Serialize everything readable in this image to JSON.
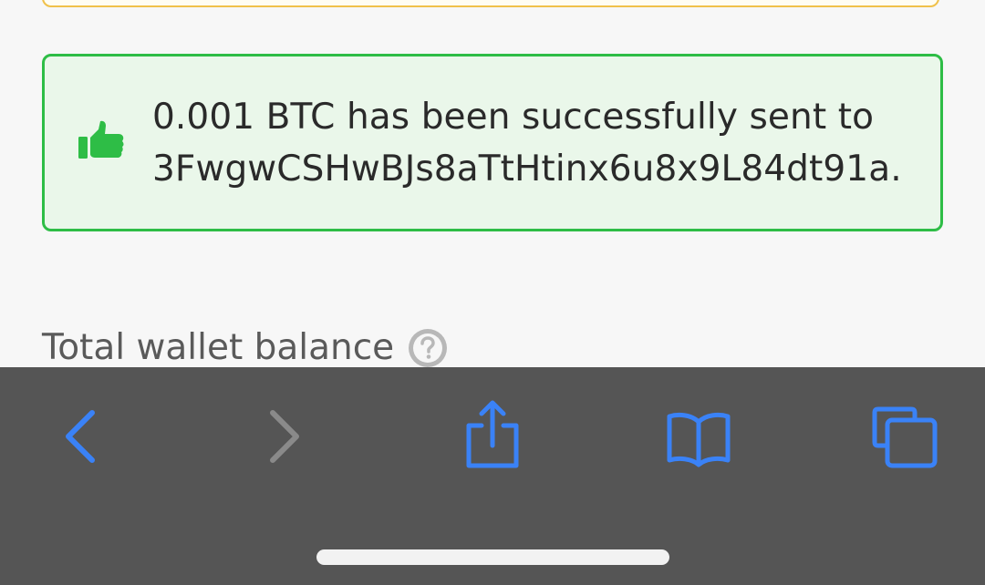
{
  "alert": {
    "message": "0.001 BTC has been successfully sent to 3FwgwCSHwBJs8aTtHtinx6u8x9L84dt91a.",
    "icon": "thumbs-up-icon",
    "accent_color": "#2ebd46"
  },
  "balance": {
    "label": "Total wallet balance",
    "help_icon": "question-circle-icon"
  },
  "toolbar": {
    "background": "#555555",
    "active_color": "#3a82f7",
    "disabled_color": "#8a8a8a",
    "buttons": [
      {
        "name": "back",
        "icon": "chevron-left-icon",
        "enabled": true
      },
      {
        "name": "forward",
        "icon": "chevron-right-icon",
        "enabled": false
      },
      {
        "name": "share",
        "icon": "share-icon",
        "enabled": true
      },
      {
        "name": "bookmarks",
        "icon": "book-icon",
        "enabled": true
      },
      {
        "name": "tabs",
        "icon": "tabs-icon",
        "enabled": true
      }
    ]
  }
}
